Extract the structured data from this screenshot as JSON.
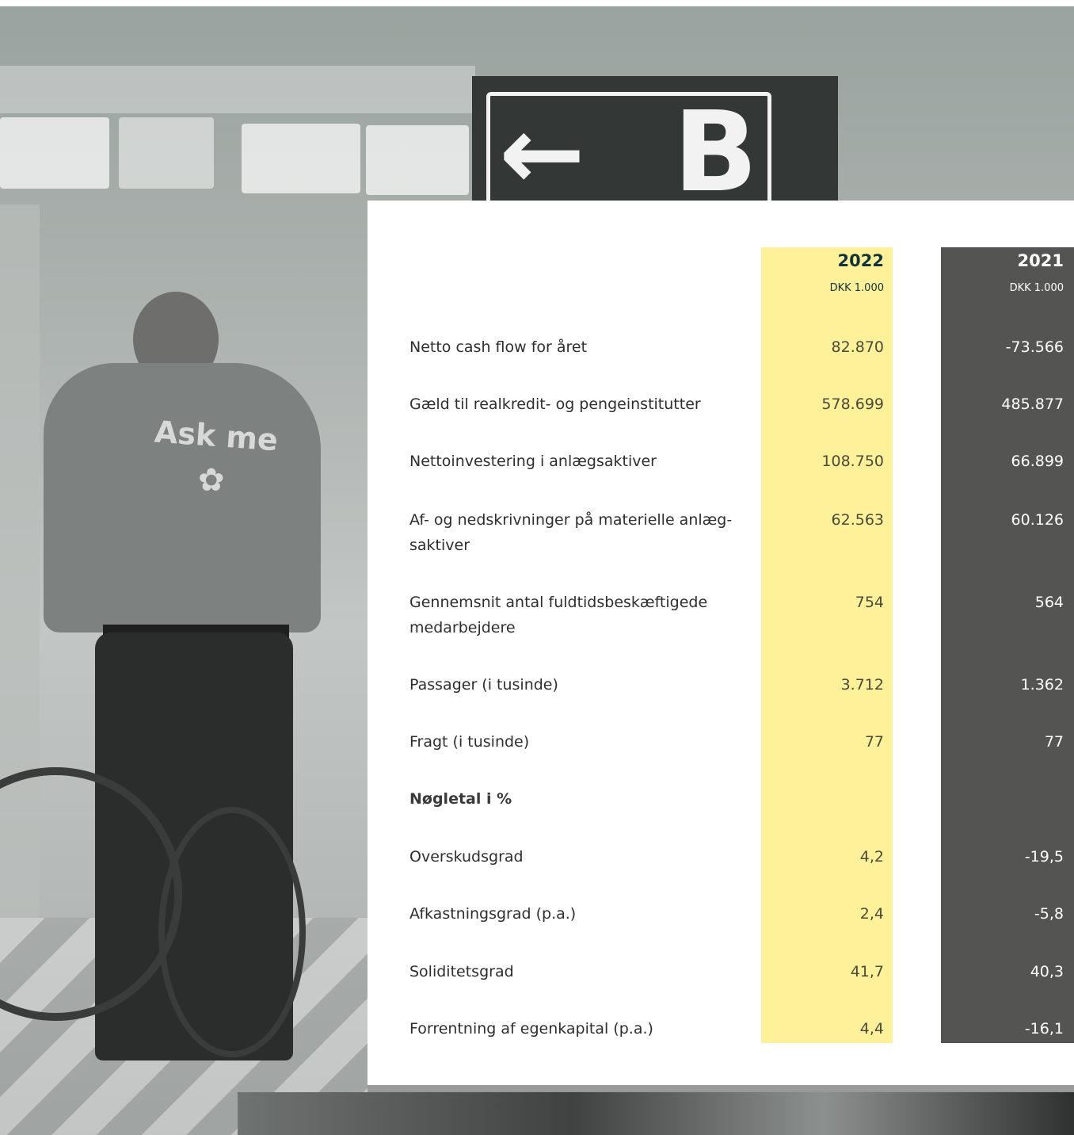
{
  "photo": {
    "shirt_text": "Ask me",
    "sign_letter": "B",
    "sign_arrow": "←",
    "bee_icon": "bee-logo-icon"
  },
  "table": {
    "columns": [
      {
        "year": "2022",
        "unit": "DKK 1.000",
        "bg": "#fff199"
      },
      {
        "year": "2021",
        "unit": "DKK 1.000",
        "bg": "#545452"
      }
    ],
    "rows": [
      {
        "label": "Netto cash flow for året",
        "v2022": "82.870",
        "v2021": "-73.566"
      },
      {
        "label": "Gæld til realkredit- og pengeinstitutter",
        "v2022": "578.699",
        "v2021": "485.877"
      },
      {
        "label": "Nettoinvestering i anlægsaktiver",
        "v2022": "108.750",
        "v2021": "66.899"
      },
      {
        "label": "Af- og nedskrivninger på materielle anlæg-saktiver",
        "v2022": "62.563",
        "v2021": "60.126"
      },
      {
        "label": "Gennemsnit antal fuldtidsbeskæftigede medarbejdere",
        "v2022": "754",
        "v2021": "564"
      },
      {
        "label": "Passager (i tusinde)",
        "v2022": "3.712",
        "v2021": "1.362"
      },
      {
        "label": "Fragt (i tusinde)",
        "v2022": "77",
        "v2021": "77"
      },
      {
        "label": "Nøgletal i %",
        "v2022": "",
        "v2021": "",
        "bold": true
      },
      {
        "label": "Overskudsgrad",
        "v2022": "4,2",
        "v2021": "-19,5"
      },
      {
        "label": "Afkastningsgrad (p.a.)",
        "v2022": "2,4",
        "v2021": "-5,8"
      },
      {
        "label": "Soliditetsgrad",
        "v2022": "41,7",
        "v2021": "40,3"
      },
      {
        "label": "Forrentning af egenkapital (p.a.)",
        "v2022": "4,4",
        "v2021": "-16,1"
      }
    ]
  }
}
